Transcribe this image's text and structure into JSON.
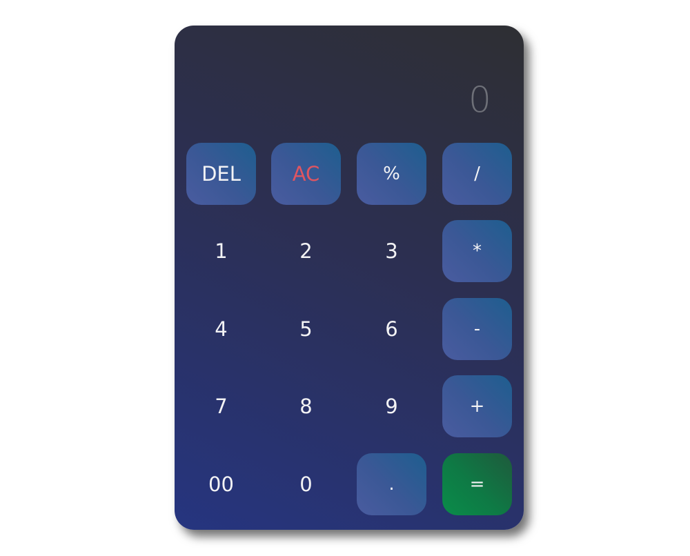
{
  "display": {
    "value": "0"
  },
  "keys": {
    "del": "DEL",
    "ac": "AC",
    "percent": "%",
    "divide": "/",
    "one": "1",
    "two": "2",
    "three": "3",
    "multiply": "*",
    "four": "4",
    "five": "5",
    "six": "6",
    "minus": "-",
    "seven": "7",
    "eight": "8",
    "nine": "9",
    "plus": "+",
    "double_zero": "00",
    "zero": "0",
    "decimal": ".",
    "equals": "="
  },
  "colors": {
    "accent_key": "#3b5896",
    "equals_key": "#0e7a45",
    "clear_text": "#e05561",
    "display_text": "#6e7078"
  }
}
